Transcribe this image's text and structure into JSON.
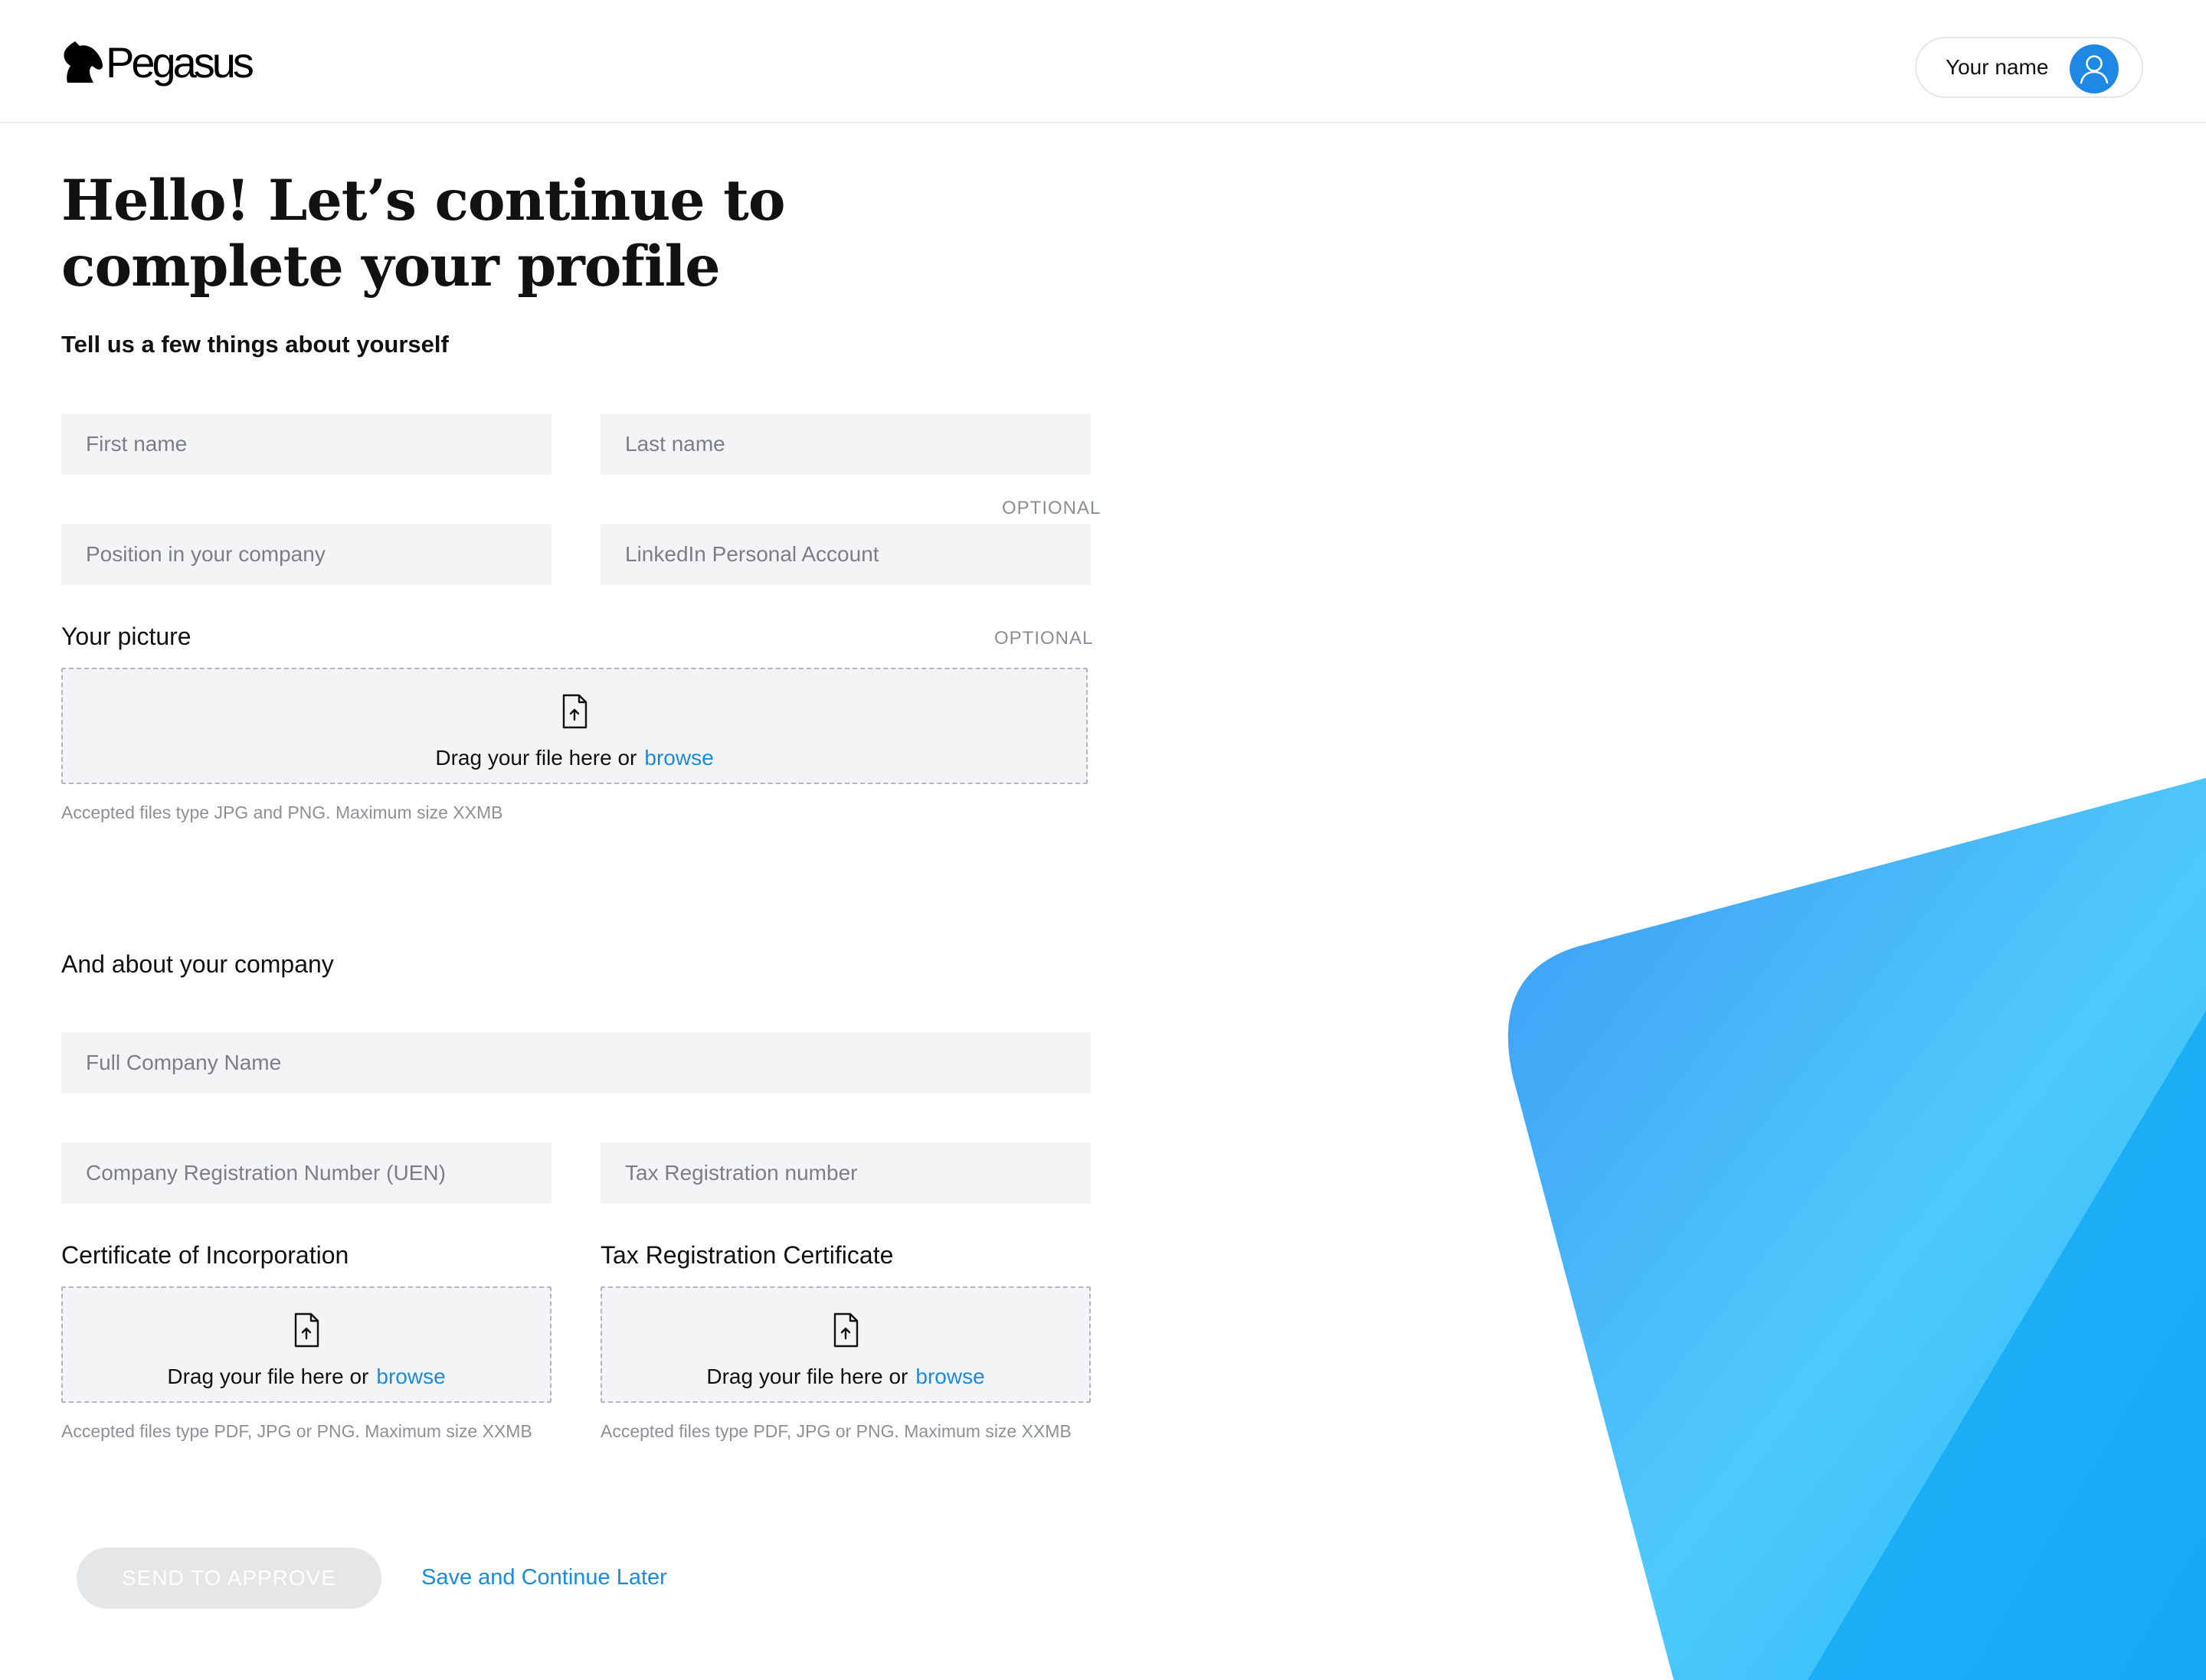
{
  "header": {
    "brand_name": "Pegasus",
    "user_label": "Your name"
  },
  "main": {
    "title_line1": "Hello! Let’s continue to",
    "title_line2": "complete your profile",
    "subtitle": "Tell us a few things about yourself",
    "personal": {
      "first_name": {
        "placeholder": "First name",
        "value": ""
      },
      "last_name": {
        "placeholder": "Last name",
        "value": ""
      },
      "position": {
        "placeholder": "Position in your company",
        "value": ""
      },
      "linkedin": {
        "placeholder": "LinkedIn Personal Account",
        "value": "",
        "optional_label": "OPTIONAL"
      },
      "picture": {
        "label": "Your picture",
        "optional_label": "OPTIONAL",
        "drop_text": "Drag your file here or",
        "browse_label": "browse",
        "hint": "Accepted files type JPG and PNG. Maximum size XXMB"
      }
    },
    "company": {
      "section_label": "And about your company",
      "full_name": {
        "placeholder": "Full Company Name",
        "value": ""
      },
      "uen": {
        "placeholder": "Company Registration Number (UEN)",
        "value": ""
      },
      "tax_number": {
        "placeholder": "Tax Registration number",
        "value": ""
      },
      "incorporation": {
        "label": "Certificate of Incorporation",
        "drop_text": "Drag your file here or",
        "browse_label": "browse",
        "hint": "Accepted files type PDF, JPG or PNG. Maximum size XXMB"
      },
      "tax_certificate": {
        "label": "Tax Registration Certificate",
        "drop_text": "Drag your file here or",
        "browse_label": "browse",
        "hint": "Accepted files type PDF, JPG or PNG. Maximum size XXMB"
      }
    },
    "actions": {
      "send_label": "SEND TO APPROVE",
      "send_disabled": true,
      "save_label": "Save and Continue Later"
    }
  },
  "colors": {
    "accent": "#1a8be0",
    "field_bg": "#f3f4f6",
    "decor_blue_dark": "#3d9bf5",
    "decor_blue_light": "#4fc9fb"
  },
  "icons": {
    "brand": "horse-head-icon",
    "avatar": "user-icon",
    "upload": "file-upload-icon"
  }
}
